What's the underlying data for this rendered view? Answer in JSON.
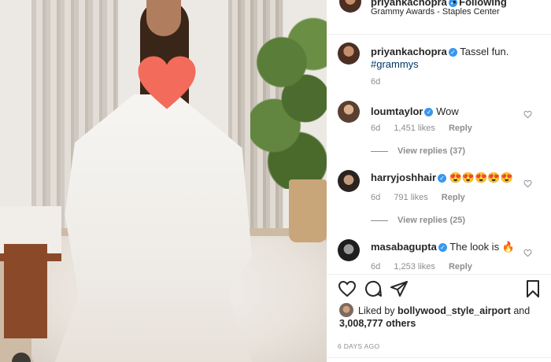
{
  "post": {
    "username": "priyankachopra",
    "follow_label": "• Following",
    "location": "Grammy Awards - Staples Center"
  },
  "comments": [
    {
      "user": "priyankachopra",
      "verified": true,
      "text": "Tassel fun.",
      "tag": "#grammys",
      "age": "6d"
    },
    {
      "user": "loumtaylor",
      "verified": true,
      "text": "Wow",
      "age": "6d",
      "likes": "1,451 likes",
      "reply": "Reply",
      "view_replies": "View replies (37)"
    },
    {
      "user": "harryjoshhair",
      "verified": true,
      "text": "😍😍😍😍😍",
      "age": "6d",
      "likes": "791 likes",
      "reply": "Reply",
      "view_replies": "View replies (25)"
    },
    {
      "user": "masabagupta",
      "verified": true,
      "text": "The look is 🔥",
      "age": "6d",
      "likes": "1,253 likes",
      "reply": "Reply"
    }
  ],
  "liked_by": {
    "prefix": "Liked by",
    "user": "bollywood_style_airport",
    "and": "and",
    "count": "3,008,777 others"
  },
  "time_ago": "6 DAYS AGO",
  "icons": {
    "like": "heart-outline-icon",
    "comment": "comment-bubble-icon",
    "share": "paper-plane-icon",
    "save": "bookmark-icon",
    "photo_overlay": "heart-sticker"
  },
  "colors": {
    "verified": "#3897f0",
    "heart_sticker": "#f26b5b",
    "muted_text": "#8e8e8e",
    "hashtag": "#00376b"
  }
}
